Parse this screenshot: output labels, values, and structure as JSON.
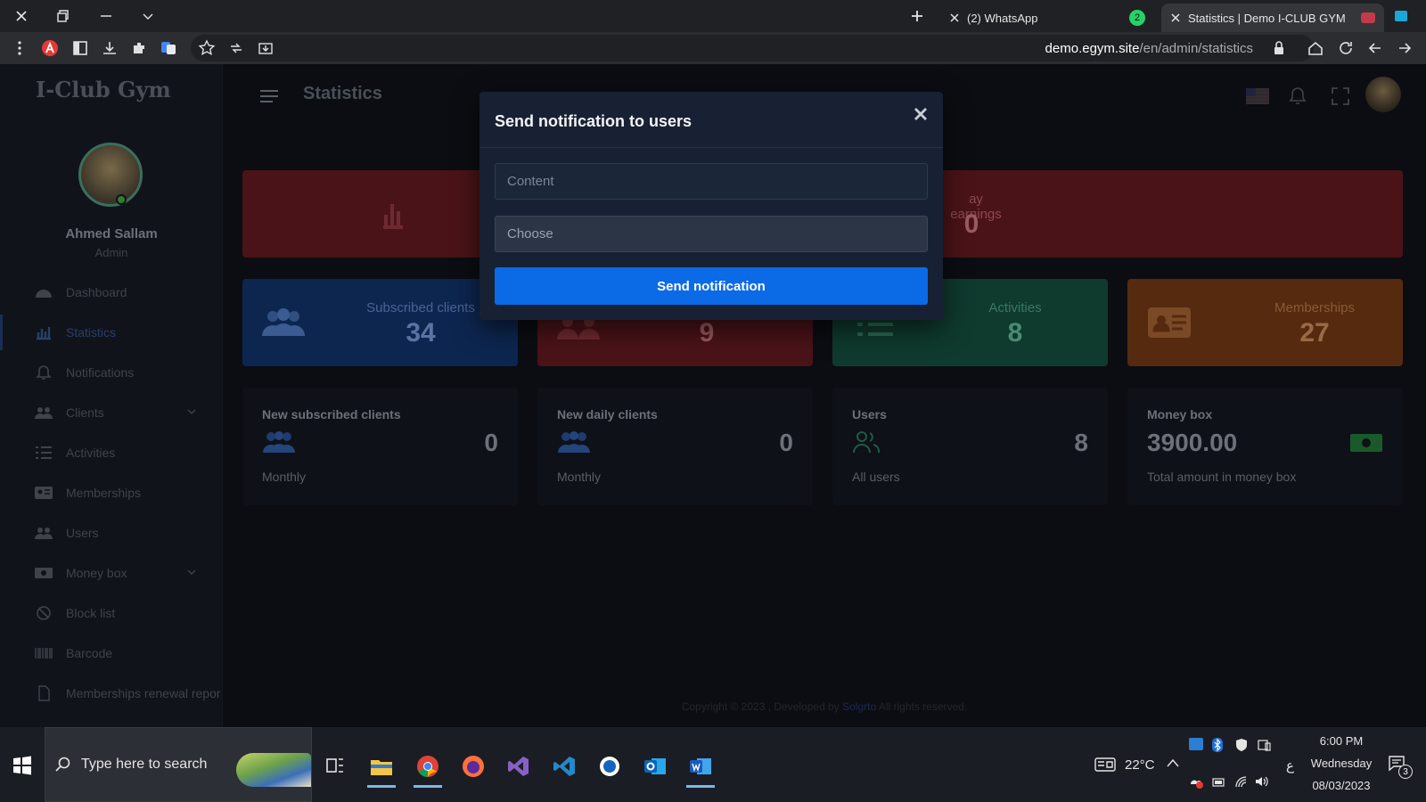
{
  "browser": {
    "tabs": [
      {
        "title": "(2) WhatsApp",
        "badge": "2"
      },
      {
        "title": "Statistics | Demo I-CLUB GYM"
      }
    ],
    "url_host": "demo.egym.site",
    "url_path": "/en/admin/statistics"
  },
  "app": {
    "brand": "I-Club Gym",
    "page_title": "Statistics",
    "user": {
      "name": "Ahmed Sallam",
      "role": "Admin"
    },
    "nav": [
      {
        "label": "Dashboard",
        "icon": "dashboard-icon"
      },
      {
        "label": "Statistics",
        "icon": "bar-chart-icon"
      },
      {
        "label": "Notifications",
        "icon": "bell-icon"
      },
      {
        "label": "Clients",
        "icon": "users-icon"
      },
      {
        "label": "Activities",
        "icon": "list-icon"
      },
      {
        "label": "Memberships",
        "icon": "id-card-icon"
      },
      {
        "label": "Users",
        "icon": "user-group-icon"
      },
      {
        "label": "Money box",
        "icon": "money-icon"
      },
      {
        "label": "Block list",
        "icon": "block-icon"
      },
      {
        "label": "Barcode",
        "icon": "barcode-icon"
      },
      {
        "label": "Memberships renewal repor",
        "icon": "document-icon"
      }
    ],
    "top_cards": {
      "earnings_label": "ay earnings",
      "earnings_value": "0"
    },
    "count_cards": [
      {
        "label": "Subscribed clients",
        "value": "34",
        "color": "#0e2a55"
      },
      {
        "label": "",
        "value": "9",
        "color": "#4f1418"
      },
      {
        "label": "Activities",
        "value": "8",
        "color": "#0f3a2e"
      },
      {
        "label": "Memberships",
        "value": "27",
        "color": "#5a2a0e"
      }
    ],
    "stats": [
      {
        "title": "New subscribed clients",
        "value": "0",
        "sub": "Monthly"
      },
      {
        "title": "New daily clients",
        "value": "0",
        "sub": "Monthly"
      },
      {
        "title": "Users",
        "value": "8",
        "sub": "All users"
      },
      {
        "title": "Money box",
        "value": "3900.00",
        "sub": "Total amount in money box"
      }
    ],
    "footer": {
      "pre": "Copyright © 2023 , Developed by",
      "link": "Solgrto",
      "post": " All rights reserved."
    }
  },
  "modal": {
    "title": "Send notification to users",
    "content_placeholder": "Content",
    "choose_placeholder": "Choose",
    "button": "Send notification"
  },
  "taskbar": {
    "search_placeholder": "Type here to search",
    "weather": "22°C",
    "time": "6:00 PM",
    "day": "Wednesday",
    "date": "08/03/2023",
    "lang": "ع",
    "notif_count": "3"
  }
}
